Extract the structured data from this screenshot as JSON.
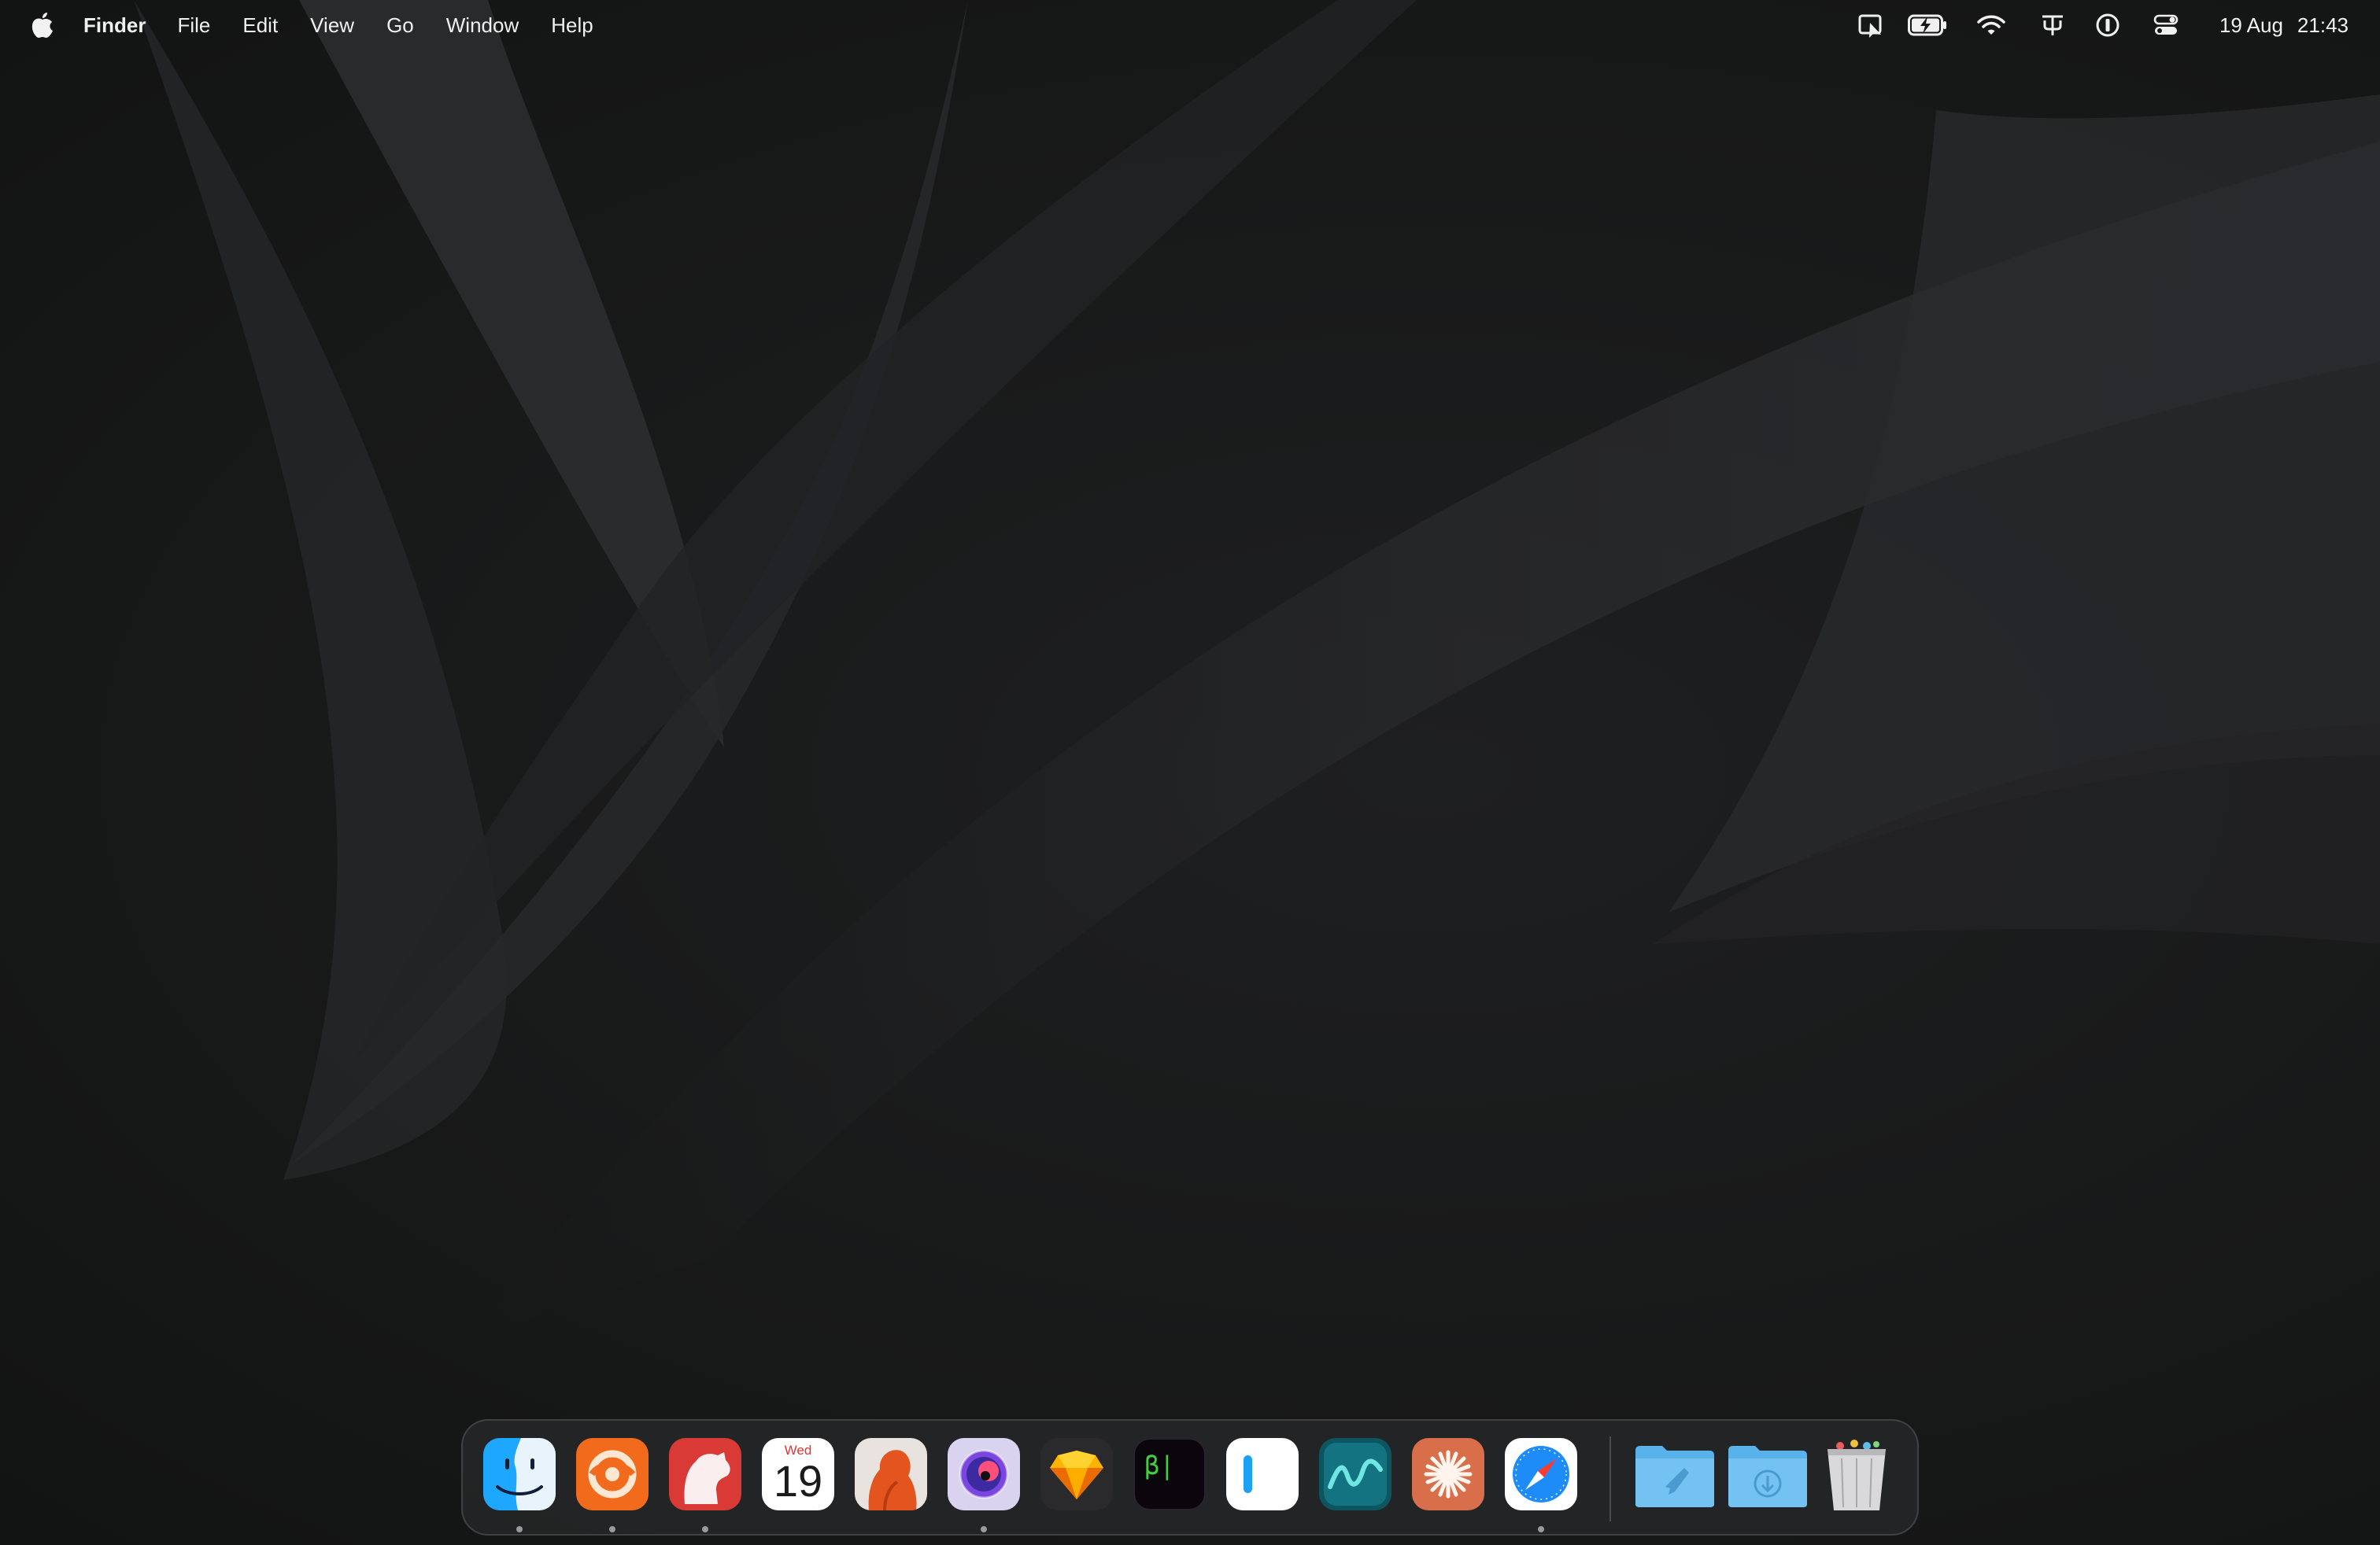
{
  "menubar": {
    "app_name": "Finder",
    "menus": [
      "File",
      "Edit",
      "View",
      "Go",
      "Window",
      "Help"
    ],
    "date": "19 Aug",
    "time": "21:43",
    "status_icons": [
      "screen-share-icon",
      "battery-charging-icon",
      "wifi-icon",
      "keyboard-input-icon",
      "password-manager-icon",
      "control-center-icon"
    ]
  },
  "dock": {
    "apps": [
      {
        "name": "finder",
        "running": true
      },
      {
        "name": "orange-app",
        "running": true
      },
      {
        "name": "bear",
        "running": true
      },
      {
        "name": "calendar",
        "running": false,
        "month": "Wed",
        "day": "19"
      },
      {
        "name": "orange-figure-app",
        "running": false
      },
      {
        "name": "purple-orb-app",
        "running": true
      },
      {
        "name": "sketch",
        "running": false
      },
      {
        "name": "beta-terminal",
        "running": false,
        "label": "β|"
      },
      {
        "name": "white-bar-app",
        "running": false
      },
      {
        "name": "teal-wave-app",
        "running": false
      },
      {
        "name": "claude",
        "running": false
      },
      {
        "name": "safari",
        "running": true
      }
    ],
    "folders": [
      {
        "name": "applications-folder"
      },
      {
        "name": "downloads-folder"
      }
    ],
    "trash": {
      "name": "trash"
    }
  },
  "colors": {
    "desktop": "#161718",
    "dock_bg": "#28292b",
    "menu_text": "#f0f0f0",
    "calendar_red": "#e8312f"
  }
}
